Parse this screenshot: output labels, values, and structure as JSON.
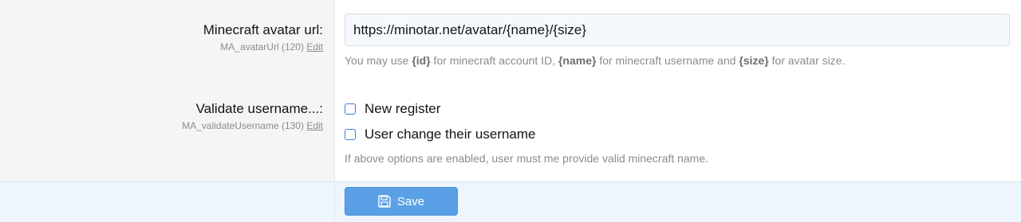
{
  "fields": {
    "avatar_url": {
      "label": "Minecraft avatar url:",
      "option_id": "MA_avatarUrl (120)",
      "edit_link": "Edit",
      "value": "https://minotar.net/avatar/{name}/{size}",
      "hint_parts": [
        "You may use ",
        "{id}",
        " for minecraft account ID, ",
        "{name}",
        " for minecraft username and ",
        "{size}",
        " for avatar size."
      ]
    },
    "validate_username": {
      "label": "Validate username...:",
      "option_id": "MA_validateUsername (130)",
      "edit_link": "Edit",
      "options": [
        {
          "label": "New register",
          "checked": false
        },
        {
          "label": "User change their username",
          "checked": false
        }
      ],
      "hint": "If above options are enabled, user must me provide valid minecraft name."
    }
  },
  "footer": {
    "save_label": "Save",
    "save_icon": "save-icon"
  },
  "colors": {
    "label_bg": "#f5f5f5",
    "footer_bg": "#eef5fc",
    "button_bg": "#5aa0e6",
    "checkbox_border": "#3d7fd3"
  }
}
